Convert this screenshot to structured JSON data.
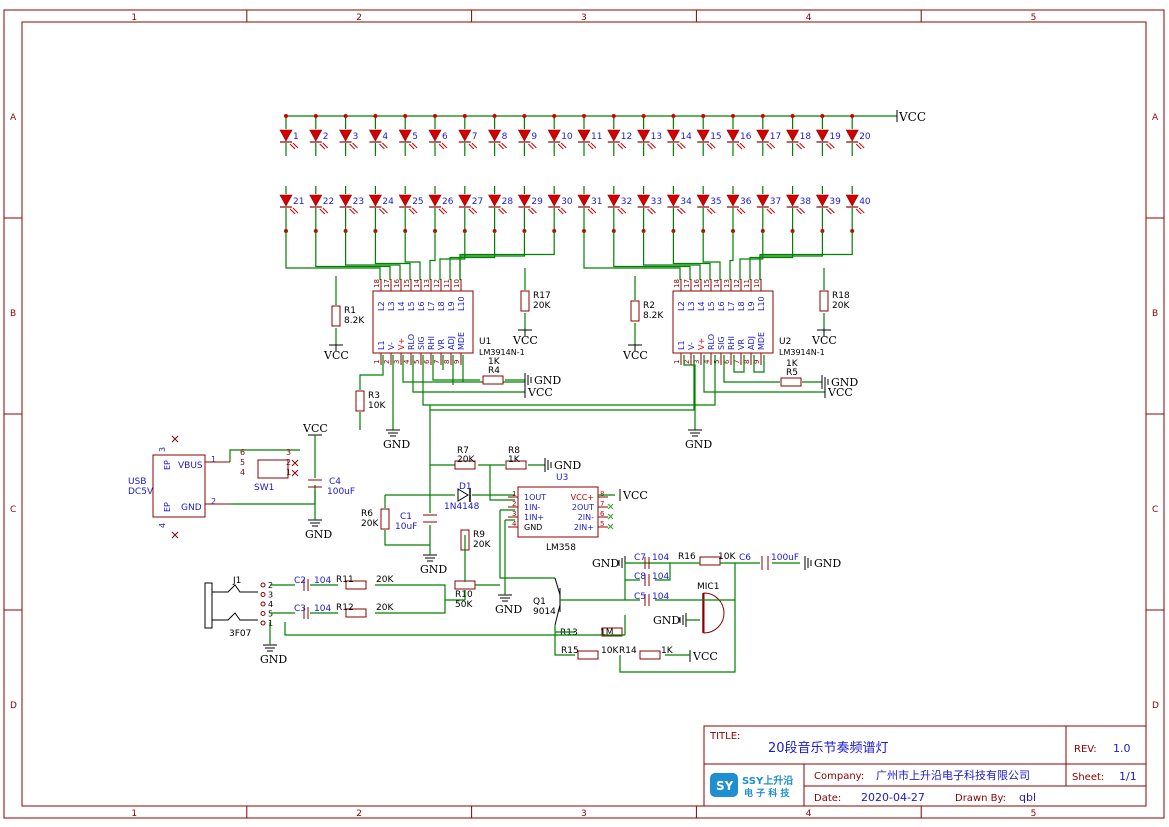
{
  "border": {
    "columns": [
      "1",
      "2",
      "3",
      "4",
      "5"
    ],
    "rows": [
      "A",
      "B",
      "C",
      "D"
    ]
  },
  "leds": {
    "top": [
      "1",
      "2",
      "3",
      "4",
      "5",
      "6",
      "7",
      "8",
      "9",
      "10",
      "11",
      "12",
      "13",
      "14",
      "15",
      "16",
      "17",
      "18",
      "19",
      "20"
    ],
    "bottom": [
      "21",
      "22",
      "23",
      "24",
      "25",
      "26",
      "27",
      "28",
      "29",
      "30",
      "31",
      "32",
      "33",
      "34",
      "35",
      "36",
      "37",
      "38",
      "39",
      "40"
    ]
  },
  "nets": {
    "vcc": "VCC",
    "gnd": "GND"
  },
  "u1": {
    "ref": "U1",
    "part": "LM3914N-1",
    "top_pins": [
      "L2",
      "L3",
      "L4",
      "L5",
      "L6",
      "L7",
      "L8",
      "L9",
      "L10"
    ],
    "top_nums": [
      "18",
      "17",
      "16",
      "15",
      "14",
      "13",
      "12",
      "11",
      "10"
    ],
    "bot_pins": [
      "L1",
      "V-",
      "V+",
      "RLO",
      "SIG",
      "RHI",
      "VR",
      "ADJ",
      "MDE"
    ],
    "bot_nums": [
      "1",
      "2",
      "3",
      "4",
      "5",
      "6",
      "7",
      "8",
      "9"
    ]
  },
  "u2": {
    "ref": "U2",
    "part": "LM3914N-1",
    "top_pins": [
      "L2",
      "L3",
      "L4",
      "L5",
      "L6",
      "L7",
      "L8",
      "L9",
      "L10"
    ],
    "top_nums": [
      "18",
      "17",
      "16",
      "15",
      "14",
      "13",
      "12",
      "11",
      "10"
    ],
    "bot_pins": [
      "L1",
      "V-",
      "V+",
      "RLO",
      "SIG",
      "RHI",
      "VR",
      "ADJ",
      "MDE"
    ],
    "bot_nums": [
      "1",
      "2",
      "3",
      "4",
      "5",
      "6",
      "7",
      "8",
      "9"
    ]
  },
  "u3": {
    "ref": "U3",
    "part": "LM358",
    "left_pins": [
      "1OUT",
      "1IN-",
      "1IN+",
      "GND"
    ],
    "left_nums": [
      "1",
      "2",
      "3",
      "4"
    ],
    "right_pins": [
      "VCC+",
      "2OUT",
      "2IN-",
      "2IN+"
    ],
    "right_nums": [
      "8",
      "7",
      "6",
      "5"
    ]
  },
  "resistors": {
    "r1": {
      "ref": "R1",
      "value": "8.2K"
    },
    "r2": {
      "ref": "R2",
      "value": "8.2K"
    },
    "r3": {
      "ref": "R3",
      "value": "10K"
    },
    "r4": {
      "ref": "R4",
      "value": "1K"
    },
    "r5": {
      "ref": "R5",
      "value": "1K"
    },
    "r6": {
      "ref": "R6",
      "value": "20K"
    },
    "r7": {
      "ref": "R7",
      "value": "20K"
    },
    "r8": {
      "ref": "R8",
      "value": "1K"
    },
    "r9": {
      "ref": "R9",
      "value": "20K"
    },
    "r10": {
      "ref": "R10",
      "value": "50K"
    },
    "r11": {
      "ref": "R11",
      "value": "20K"
    },
    "r12": {
      "ref": "R12",
      "value": "20K"
    },
    "r13": {
      "ref": "R13",
      "value": "1M"
    },
    "r14": {
      "ref": "R14",
      "value": "1K"
    },
    "r15": {
      "ref": "R15",
      "value": "10K"
    },
    "r16": {
      "ref": "R16",
      "value": "10K"
    },
    "r17": {
      "ref": "R17",
      "value": "20K"
    },
    "r18": {
      "ref": "R18",
      "value": "20K"
    }
  },
  "capacitors": {
    "c1": {
      "ref": "C1",
      "value": "10uF"
    },
    "c2": {
      "ref": "C2",
      "value": "104"
    },
    "c3": {
      "ref": "C3",
      "value": "104"
    },
    "c4": {
      "ref": "C4",
      "value": "100uF"
    },
    "c5": {
      "ref": "C5",
      "value": "104"
    },
    "c6": {
      "ref": "C6",
      "value": "100uF"
    },
    "c7": {
      "ref": "C7",
      "value": "104"
    },
    "c8": {
      "ref": "C8",
      "value": "104"
    }
  },
  "d1": {
    "ref": "D1",
    "value": "1N4148"
  },
  "q1": {
    "ref": "Q1",
    "value": "9014"
  },
  "mic": {
    "ref": "MIC1"
  },
  "usb": {
    "name": "USB",
    "value": "DC5V",
    "vbus": "VBUS",
    "gnd": "GND",
    "ep": "EP"
  },
  "sw1": {
    "ref": "SW1"
  },
  "j1": {
    "ref": "J1",
    "value": "3F07"
  },
  "title_block": {
    "title_label": "TITLE:",
    "title": "20段音乐节奏频谱灯",
    "rev_label": "REV:",
    "rev": "1.0",
    "company_label": "Company:",
    "company": "广州市上升沿电子科技有限公司",
    "sheet_label": "Sheet:",
    "sheet": "1/1",
    "date_label": "Date:",
    "date": "2020-04-27",
    "drawn_label": "Drawn By:",
    "drawn": "qbl",
    "logo_brand": "SSY上升沿",
    "logo_sub": "电 子 科 技"
  },
  "colors": {
    "frame": "#8b0000",
    "wire": "#008000",
    "led": "#d40000",
    "text": "#1a1ad0"
  }
}
